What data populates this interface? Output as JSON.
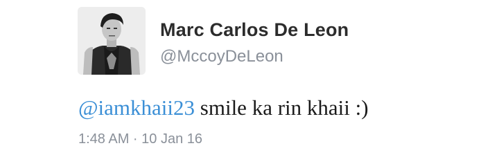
{
  "tweet": {
    "author": {
      "display_name": "Marc Carlos De Leon",
      "handle": "@MccoyDeLeon",
      "avatar": "profile-photo"
    },
    "text": {
      "mention": "@iamkhaii23",
      "body": " smile ka rin khaii :)"
    },
    "timestamp": "1:48 AM · 10 Jan 16"
  },
  "colors": {
    "name": "#2c2c2c",
    "handle": "#8a9099",
    "mention": "#3b8fd6",
    "text": "#1a1a1a",
    "timestamp": "#8a9099"
  }
}
